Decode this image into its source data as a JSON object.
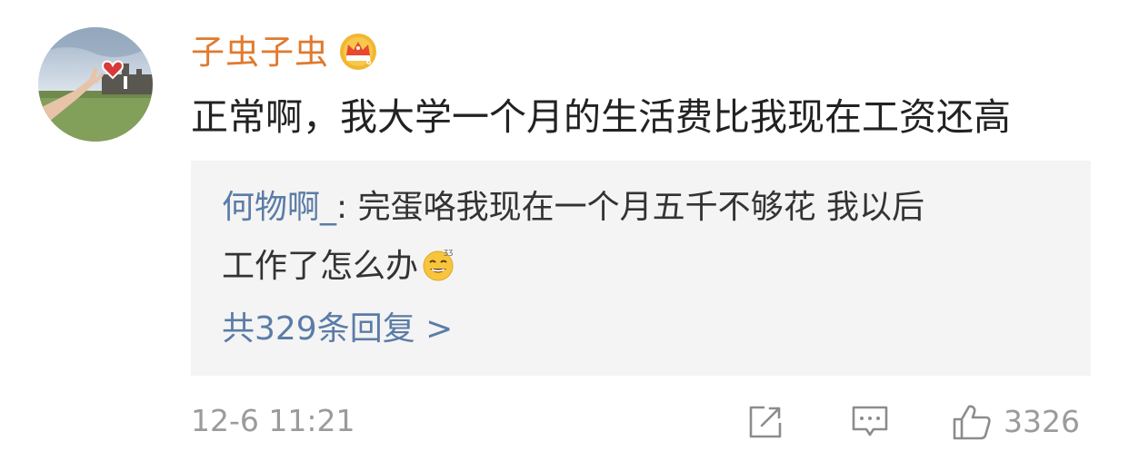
{
  "comment": {
    "username": "子虫子虫",
    "text": "正常啊，我大学一个月的生活费比我现在工资还高",
    "badge_icon": "crown-badge-icon",
    "username_color": "#e07a2f"
  },
  "reply": {
    "author": "何物啊_",
    "line1_rest": ": 完蛋咯我现在一个月五千不够花 我以后",
    "line2": "工作了怎么办",
    "emoji_icon": "sweat-smile-emoji-icon",
    "more_label": "共329条回复 >",
    "link_color": "#5b7ca6"
  },
  "footer": {
    "timestamp": "12-6 11:21",
    "like_count": "3326",
    "icons": [
      "share-icon",
      "comment-icon",
      "like-icon"
    ]
  }
}
